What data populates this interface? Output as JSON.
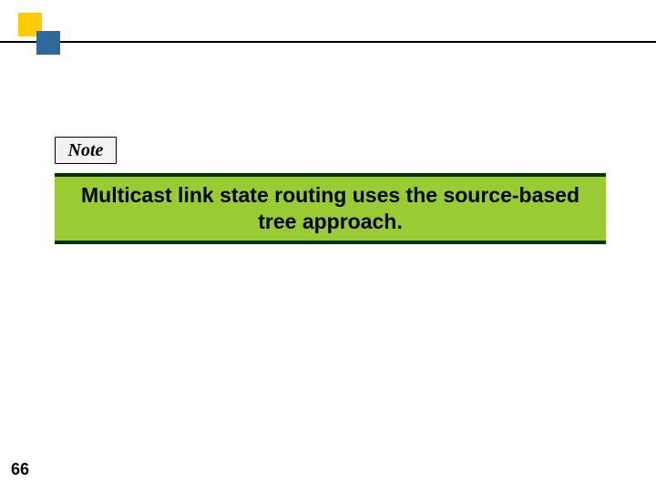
{
  "note_label": "Note",
  "note_text": "Multicast link state routing uses the source-based tree approach.",
  "page_number": "66",
  "colors": {
    "accent_yellow": "#ffcc00",
    "accent_blue": "#336699",
    "banner_bg": "#99cc33",
    "banner_border": "#003300"
  }
}
